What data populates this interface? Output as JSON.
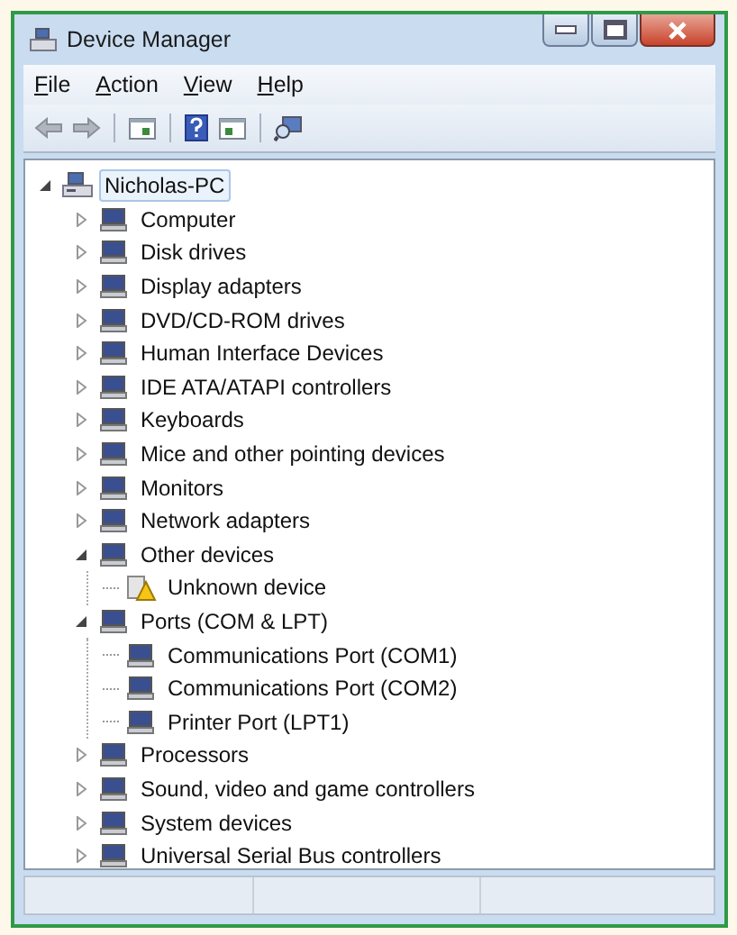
{
  "window": {
    "title": "Device Manager"
  },
  "menu": [
    "File",
    "Action",
    "View",
    "Help"
  ],
  "tree": [
    {
      "label": "Nicholas-PC",
      "expanded": true,
      "selected": true,
      "children": [
        {
          "label": "Computer",
          "expanded": false,
          "selected": false
        },
        {
          "label": "Disk drives",
          "expanded": false,
          "selected": false
        },
        {
          "label": "Display adapters",
          "expanded": false,
          "selected": false
        },
        {
          "label": "DVD/CD-ROM drives",
          "expanded": false,
          "selected": false
        },
        {
          "label": "Human Interface Devices",
          "expanded": false,
          "selected": false
        },
        {
          "label": "IDE ATA/ATAPI controllers",
          "expanded": false,
          "selected": false
        },
        {
          "label": "Keyboards",
          "expanded": false,
          "selected": false
        },
        {
          "label": "Mice and other pointing devices",
          "expanded": false,
          "selected": false
        },
        {
          "label": "Monitors",
          "expanded": false,
          "selected": false
        },
        {
          "label": "Network adapters",
          "expanded": false,
          "selected": false
        },
        {
          "label": "Other devices",
          "expanded": true,
          "selected": false,
          "children": [
            {
              "label": "Unknown device",
              "selected": false,
              "warning": true
            }
          ]
        },
        {
          "label": "Ports (COM & LPT)",
          "expanded": true,
          "selected": false,
          "children": [
            {
              "label": "Communications Port (COM1)",
              "selected": false,
              "warning": false
            },
            {
              "label": "Communications Port (COM2)",
              "selected": false,
              "warning": false
            },
            {
              "label": "Printer Port (LPT1)",
              "selected": false,
              "warning": false
            }
          ]
        },
        {
          "label": "Processors",
          "expanded": false,
          "selected": false
        },
        {
          "label": "Sound, video and game controllers",
          "expanded": false,
          "selected": false
        },
        {
          "label": "System devices",
          "expanded": false,
          "selected": false
        },
        {
          "label": "Universal Serial Bus controllers",
          "expanded": false,
          "selected": false
        }
      ]
    }
  ]
}
